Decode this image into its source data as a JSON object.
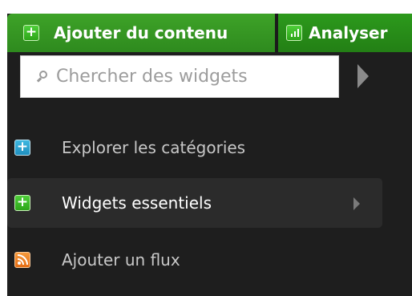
{
  "tabs": [
    {
      "label": "Ajouter du contenu",
      "icon": "plus-icon"
    },
    {
      "label": "Analyser",
      "icon": "bar-chart-icon"
    }
  ],
  "search": {
    "placeholder": "Chercher des widgets",
    "value": ""
  },
  "menu": {
    "items": [
      {
        "label": "Explorer les catégories",
        "icon": "plus-icon",
        "color": "#2a9fd0"
      },
      {
        "label": "Widgets essentiels",
        "icon": "plus-icon",
        "color": "#3cbd2a",
        "has_submenu": true
      },
      {
        "label": "Ajouter un flux",
        "icon": "rss-icon",
        "color": "#ef8226"
      }
    ]
  },
  "colors": {
    "panel_bg": "#1e1e1e",
    "tab_green": "#3ea328",
    "highlight_bg": "#2b2b2b"
  }
}
